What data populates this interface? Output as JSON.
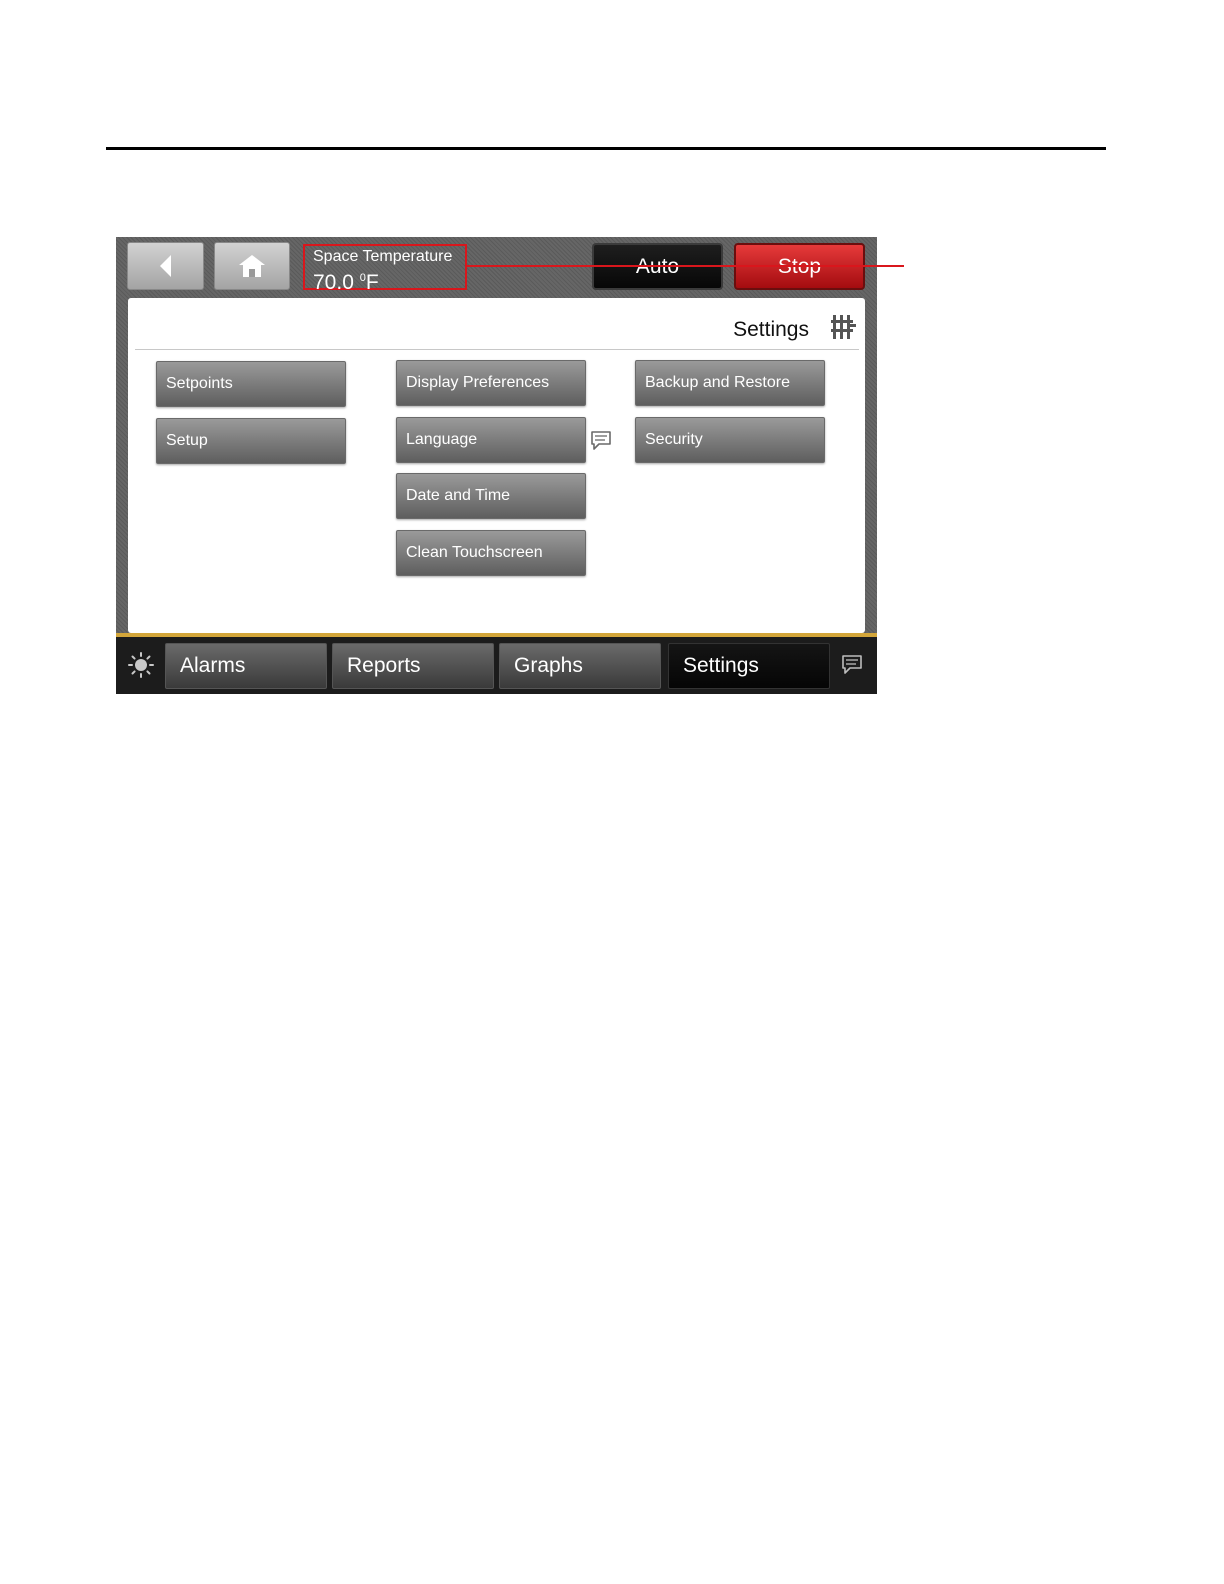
{
  "header": {
    "sensor_label": "Space Temperature",
    "sensor_value": "70.0",
    "sensor_unit_sup": "0",
    "sensor_unit": "F",
    "auto_label": "Auto",
    "stop_label": "Stop"
  },
  "panel": {
    "title": "Settings"
  },
  "menu": {
    "setpoints": "Setpoints",
    "setup": "Setup",
    "display_preferences": "Display Preferences",
    "language": "Language",
    "date_and_time": "Date and Time",
    "clean_touchscreen": "Clean Touchscreen",
    "backup_and_restore": "Backup and Restore",
    "security": "Security"
  },
  "tabs": [
    {
      "label": "Alarms"
    },
    {
      "label": "Reports"
    },
    {
      "label": "Graphs"
    },
    {
      "label": "Settings"
    }
  ],
  "colors": {
    "callout": "#d9161c",
    "stop": "#c81e22",
    "accent_strip": "#d3a63a"
  },
  "icons": {
    "back": "chevron-left-icon",
    "home": "home-icon",
    "settings": "sliders-icon",
    "language_help": "message-icon",
    "brightness": "sun-icon",
    "help": "message-icon"
  }
}
